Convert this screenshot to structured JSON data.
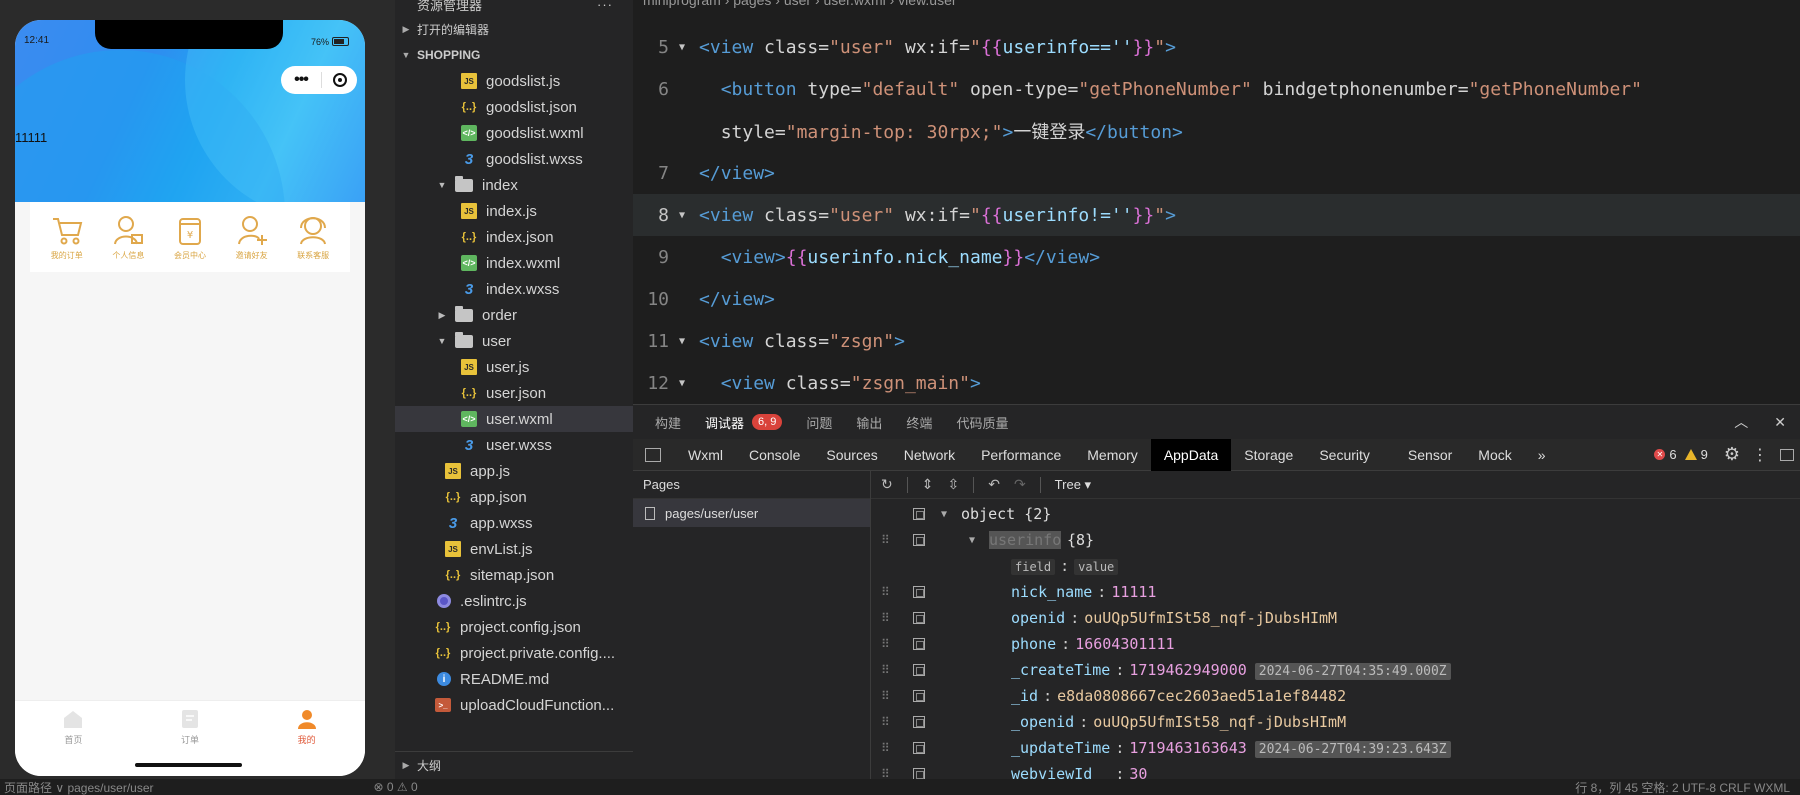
{
  "simulator": {
    "time": "12:41",
    "battery": "76%",
    "hero_text": "11111",
    "menu": [
      {
        "label": "我的订单",
        "icon": "cart-icon"
      },
      {
        "label": "个人信息",
        "icon": "user-card-icon"
      },
      {
        "label": "会员中心",
        "icon": "yen-jar-icon"
      },
      {
        "label": "邀请好友",
        "icon": "add-user-icon"
      },
      {
        "label": "联系客服",
        "icon": "headset-icon"
      }
    ],
    "tabs": [
      {
        "label": "首页",
        "icon": "home-icon"
      },
      {
        "label": "订单",
        "icon": "order-icon"
      },
      {
        "label": "我的",
        "icon": "me-icon"
      }
    ]
  },
  "explorer": {
    "title": "资源管理器",
    "more": "···",
    "open_editors": "打开的编辑器",
    "project": "SHOPPING",
    "outline": "大纲",
    "files": [
      {
        "name": "goodslist.js",
        "type": "js"
      },
      {
        "name": "goodslist.json",
        "type": "json"
      },
      {
        "name": "goodslist.wxml",
        "type": "wxml"
      },
      {
        "name": "goodslist.wxss",
        "type": "wxss"
      },
      {
        "name": "index",
        "type": "folder"
      },
      {
        "name": "index.js",
        "type": "js"
      },
      {
        "name": "index.json",
        "type": "json"
      },
      {
        "name": "index.wxml",
        "type": "wxml"
      },
      {
        "name": "index.wxss",
        "type": "wxss"
      },
      {
        "name": "order",
        "type": "folder"
      },
      {
        "name": "user",
        "type": "folder"
      },
      {
        "name": "user.js",
        "type": "js"
      },
      {
        "name": "user.json",
        "type": "json"
      },
      {
        "name": "user.wxml",
        "type": "wxml"
      },
      {
        "name": "user.wxss",
        "type": "wxss"
      },
      {
        "name": "app.js",
        "type": "js"
      },
      {
        "name": "app.json",
        "type": "json"
      },
      {
        "name": "app.wxss",
        "type": "wxss"
      },
      {
        "name": "envList.js",
        "type": "js"
      },
      {
        "name": "sitemap.json",
        "type": "json"
      },
      {
        "name": ".eslintrc.js",
        "type": "eslint"
      },
      {
        "name": "project.config.json",
        "type": "json"
      },
      {
        "name": "project.private.config....",
        "type": "json"
      },
      {
        "name": "README.md",
        "type": "info"
      },
      {
        "name": "uploadCloudFunction...",
        "type": "upload"
      }
    ]
  },
  "editor": {
    "breadcrumb": "miniprogram  ›  pages  ›  user  ›  user.wxml  ›  view.user",
    "lines": [
      {
        "num": "5"
      },
      {
        "num": "6"
      },
      {
        "num": ""
      },
      {
        "num": "7"
      },
      {
        "num": "8"
      },
      {
        "num": "9"
      },
      {
        "num": "10"
      },
      {
        "num": "11"
      },
      {
        "num": "12"
      }
    ],
    "text": {
      "view": "view",
      "button": "button",
      "class_attr": "class",
      "wxif_attr": "wx:if",
      "user": "user",
      "zsgn": "zsgn",
      "zsgn_main": "zsgn_main",
      "cond_eq": "userinfo==''",
      "cond_ne": "userinfo!=''",
      "type_attr": "type",
      "type_val": "default",
      "opentype_attr": "open-type",
      "opentype_val": "getPhoneNumber",
      "bind_attr": "bindgetphonenumber",
      "bind_val": "getPhoneNumber",
      "style_attr": "style",
      "style_val": "margin-top: 30rpx;",
      "login_text": "一键登录",
      "nick_expr": "userinfo.nick_name"
    }
  },
  "debugger": {
    "tabs": [
      "构建",
      "调试器",
      "问题",
      "输出",
      "终端",
      "代码质量"
    ],
    "badge": "6, 9",
    "toolbar": [
      "Wxml",
      "Console",
      "Sources",
      "Network",
      "Performance",
      "Memory",
      "AppData",
      "Storage",
      "Security",
      "Sensor",
      "Mock"
    ],
    "active_tool": "AppData",
    "overflow": "»",
    "errors": "6",
    "warnings": "9",
    "pages_title": "Pages",
    "page_item": "pages/user/user",
    "tree_mode": "Tree",
    "root": "object {2}",
    "selected_key": "userinfo",
    "selected_count": "{8}",
    "field_label": "field",
    "value_label": "value",
    "rows": [
      {
        "key": "nick_name",
        "value": "11111",
        "kind": "num"
      },
      {
        "key": "openid",
        "value": "ouUQp5UfmISt58_nqf-jDubsHImM",
        "kind": "str"
      },
      {
        "key": "phone",
        "value": "16604301111",
        "kind": "num"
      },
      {
        "key": "_createTime",
        "value": "1719462949000",
        "kind": "num",
        "ts": "2024-06-27T04:35:49.000Z"
      },
      {
        "key": "_id",
        "value": "e8da0808667cec2603aed51a1ef84482",
        "kind": "str"
      },
      {
        "key": "_openid",
        "value": "ouUQp5UfmISt58_nqf-jDubsHImM",
        "kind": "str"
      },
      {
        "key": "_updateTime",
        "value": "1719463163643",
        "kind": "num",
        "ts": "2024-06-27T04:39:23.643Z"
      },
      {
        "key": "webviewId__",
        "value": "30",
        "kind": "num"
      }
    ]
  },
  "statusbar": {
    "left": "页面路径 ∨   pages/user/user",
    "problems": "⊗ 0 ⚠ 0",
    "right": "行 8，列 45   空格: 2   UTF-8   CRLF   WXML"
  }
}
